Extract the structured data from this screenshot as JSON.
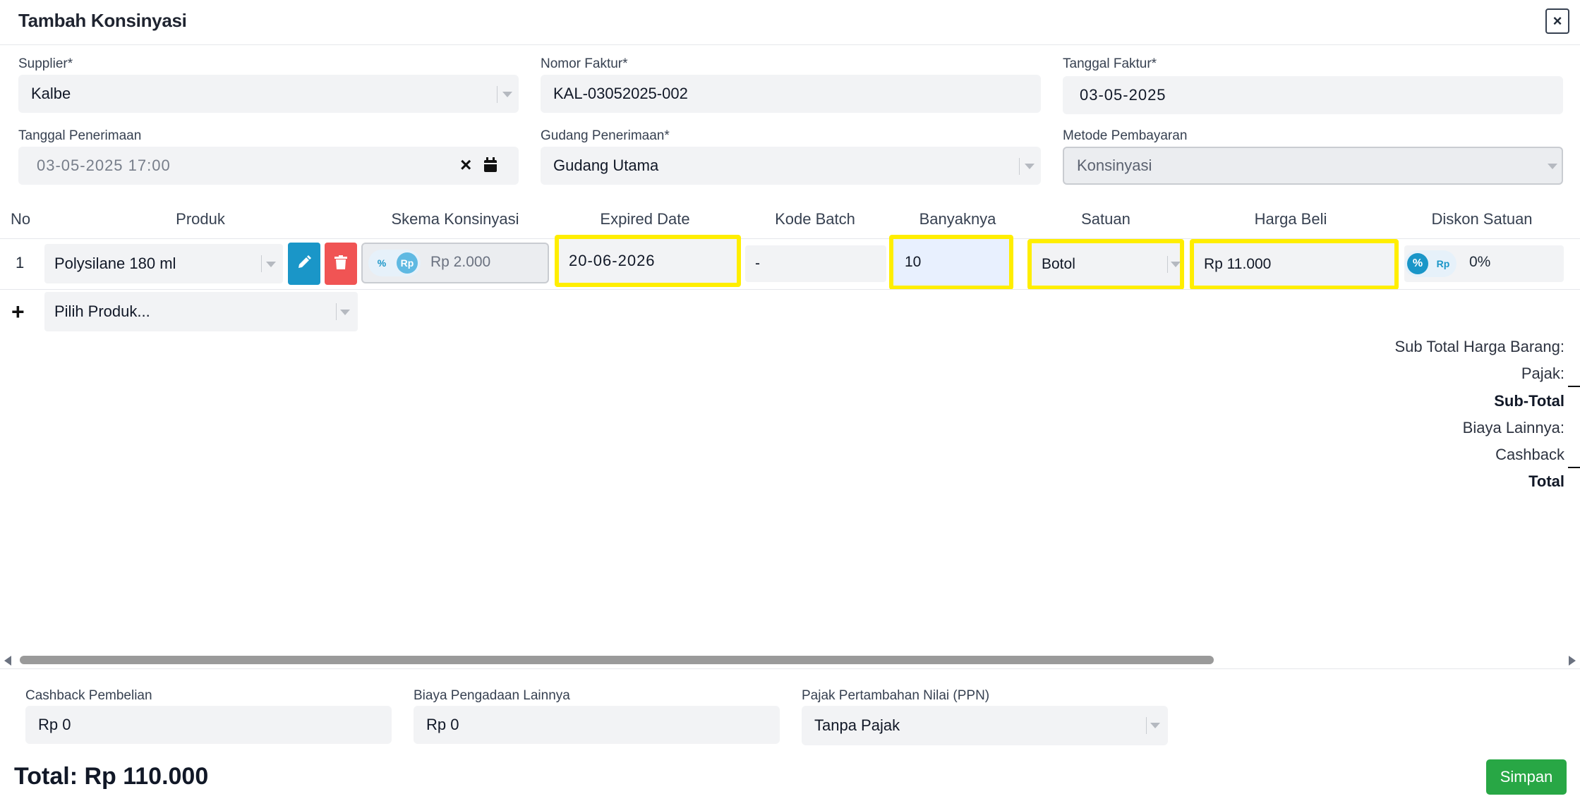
{
  "modal": {
    "title": "Tambah Konsinyasi",
    "close_label": "×"
  },
  "form": {
    "supplier": {
      "label": "Supplier*",
      "value": "Kalbe"
    },
    "nomor_faktur": {
      "label": "Nomor Faktur*",
      "value": "KAL-03052025-002"
    },
    "tanggal_faktur": {
      "label": "Tanggal Faktur*",
      "value": "03-05-2025"
    },
    "tanggal_penerimaan": {
      "label": "Tanggal Penerimaan",
      "value": "03-05-2025 17:00",
      "clear_icon": "×"
    },
    "gudang_penerimaan": {
      "label": "Gudang Penerimaan*",
      "value": "Gudang Utama"
    },
    "metode_pembayaran": {
      "label": "Metode Pembayaran",
      "value": "Konsinyasi"
    }
  },
  "table": {
    "headers": {
      "no": "No",
      "produk": "Produk",
      "skema": "Skema Konsinyasi",
      "expired": "Expired Date",
      "batch": "Kode Batch",
      "banyaknya": "Banyaknya",
      "satuan": "Satuan",
      "harga": "Harga Beli",
      "diskon": "Diskon Satuan"
    },
    "rows": [
      {
        "no": "1",
        "produk": "Polysilane 180 ml",
        "skema_pct": "%",
        "skema_rp": "Rp",
        "skema_value": "Rp 2.000",
        "expired": "20-06-2026",
        "batch": "-",
        "banyaknya": "10",
        "satuan": "Botol",
        "harga": "Rp 11.000",
        "diskon_pct": "%",
        "diskon_rp": "Rp",
        "diskon_value": "0%"
      }
    ],
    "add_symbol": "+",
    "add_placeholder": "Pilih Produk..."
  },
  "summary": {
    "sub_total_harga": "Sub Total Harga Barang:",
    "pajak": "Pajak:",
    "sub_total": "Sub-Total",
    "biaya_lainnya": "Biaya Lainnya:",
    "cashback": "Cashback",
    "total": "Total"
  },
  "footer": {
    "cashback": {
      "label": "Cashback Pembelian",
      "value": "Rp 0"
    },
    "biaya": {
      "label": "Biaya Pengadaan Lainnya",
      "value": "Rp 0"
    },
    "ppn": {
      "label": "Pajak Pertambahan Nilai (PPN)",
      "value": "Tanpa Pajak"
    },
    "total_text": "Total: Rp 110.000",
    "save_label": "Simpan"
  },
  "colors": {
    "accent_blue": "#1a96c8",
    "delete_red": "#f05454",
    "save_green": "#28a745",
    "highlight_yellow": "#ffee00"
  }
}
